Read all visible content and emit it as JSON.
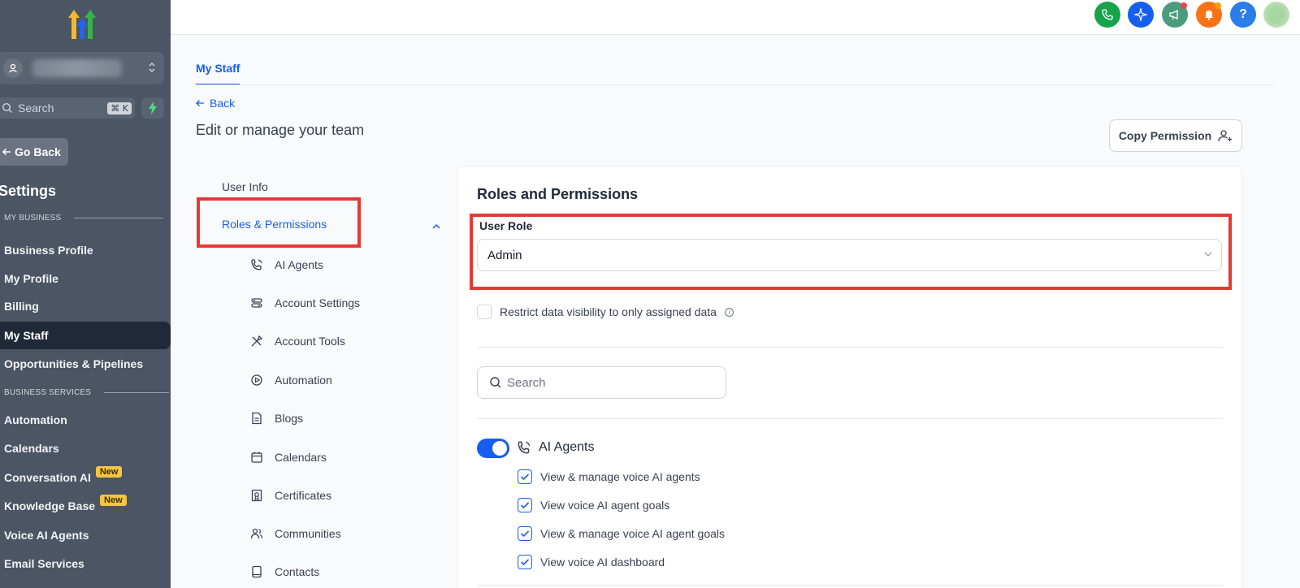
{
  "sidebar": {
    "search_placeholder": "Search",
    "search_shortcut": "⌘ K",
    "go_back": "Go Back",
    "settings_title": "Settings",
    "section_my_business": "MY BUSINESS",
    "section_business_services": "BUSINESS SERVICES",
    "items": [
      {
        "label": "Business Profile"
      },
      {
        "label": "My Profile"
      },
      {
        "label": "Billing"
      },
      {
        "label": "My Staff"
      },
      {
        "label": "Opportunities & Pipelines"
      },
      {
        "label": "Automation"
      },
      {
        "label": "Calendars"
      },
      {
        "label": "Conversation AI",
        "badge": "New"
      },
      {
        "label": "Knowledge Base",
        "badge": "New"
      },
      {
        "label": "Voice AI Agents"
      },
      {
        "label": "Email Services"
      }
    ]
  },
  "topbar": {
    "icons": [
      "phone-icon",
      "sparkle-icon",
      "megaphone-icon",
      "bell-icon",
      "help-icon",
      "avatar"
    ],
    "colors": {
      "phone": "#16a34a",
      "sparkle": "#155eef",
      "megaphone": "#4b9c7c",
      "bell": "#f97316",
      "help": "#2b7de9"
    },
    "help_label": "?"
  },
  "main": {
    "tab": "My Staff",
    "back": "Back",
    "page_title": "Edit or manage your team",
    "copy_permission": "Copy Permission"
  },
  "subnav": {
    "user_info": "User Info",
    "roles": "Roles & Permissions",
    "items": [
      {
        "label": "AI Agents",
        "icon": "phone-wave-icon"
      },
      {
        "label": "Account Settings",
        "icon": "settings-sliders-icon"
      },
      {
        "label": "Account Tools",
        "icon": "tools-icon"
      },
      {
        "label": "Automation",
        "icon": "play-circle-icon"
      },
      {
        "label": "Blogs",
        "icon": "document-icon"
      },
      {
        "label": "Calendars",
        "icon": "calendar-icon"
      },
      {
        "label": "Certificates",
        "icon": "certificate-icon"
      },
      {
        "label": "Communities",
        "icon": "users-icon"
      },
      {
        "label": "Contacts",
        "icon": "contact-book-icon"
      }
    ]
  },
  "panel": {
    "title": "Roles and Permissions",
    "user_role_label": "User Role",
    "user_role_value": "Admin",
    "restrict_label": "Restrict data visibility to only assigned data",
    "search_placeholder": "Search",
    "group": {
      "title": "AI Agents",
      "enabled": true,
      "permissions": [
        {
          "label": "View & manage voice AI agents",
          "checked": true
        },
        {
          "label": "View voice AI agent goals",
          "checked": true
        },
        {
          "label": "View & manage voice AI agent goals",
          "checked": true
        },
        {
          "label": "View voice AI dashboard",
          "checked": true
        }
      ]
    }
  }
}
